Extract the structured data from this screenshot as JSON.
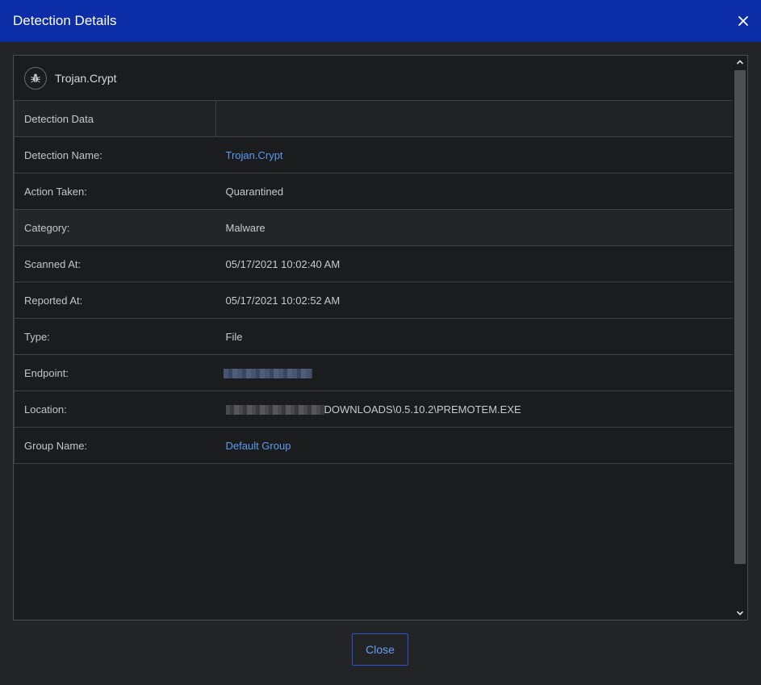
{
  "dialog": {
    "title": "Detection Details",
    "close_button_label": "Close"
  },
  "threat": {
    "name": "Trojan.Crypt",
    "icon": "bug-icon"
  },
  "table": {
    "header": "Detection Data",
    "rows": [
      {
        "label": "Detection Name:",
        "value": "Trojan.Crypt",
        "link": true
      },
      {
        "label": "Action Taken:",
        "value": "Quarantined"
      },
      {
        "label": "Category:",
        "value": "Malware"
      },
      {
        "label": "Scanned At:",
        "value": "05/17/2021 10:02:40 AM"
      },
      {
        "label": "Reported At:",
        "value": "05/17/2021 10:02:52 AM"
      },
      {
        "label": "Type:",
        "value": "File"
      },
      {
        "label": "Endpoint:",
        "value": "",
        "redacted": true
      },
      {
        "label": "Location:",
        "value": "DOWNLOADS\\0.5.10.2\\PREMOTEM.EXE",
        "redacted_prefix": true
      },
      {
        "label": "Group Name:",
        "value": "Default Group",
        "link": true
      }
    ]
  },
  "colors": {
    "titlebar": "#0b2da7",
    "link": "#5a9cf0",
    "background": "#232426"
  }
}
